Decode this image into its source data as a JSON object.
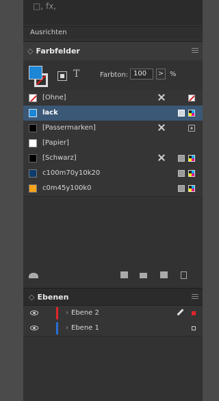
{
  "top": {
    "icons_text": "□, fx,"
  },
  "ausrichten": {
    "label": "Ausrichten"
  },
  "swatches_panel": {
    "title": "Farbfelder",
    "tint_label": "Farbton:",
    "tint_value": "100",
    "tint_arrow": ">",
    "tint_unit": "%",
    "swatches": [
      {
        "name": "[Ohne]",
        "color": "none",
        "selected": false
      },
      {
        "name": "lack",
        "color": "#1d86d6",
        "selected": true
      },
      {
        "name": "[Passermarken]",
        "color": "#000000",
        "selected": false
      },
      {
        "name": "[Papier]",
        "color": "#ffffff",
        "selected": false
      },
      {
        "name": "[Schwarz]",
        "color": "#000000",
        "selected": false
      },
      {
        "name": "c100m70y10k20",
        "color": "#0e3c6e",
        "selected": false
      },
      {
        "name": "c0m45y100k0",
        "color": "#f7a21b",
        "selected": false
      }
    ]
  },
  "layers_panel": {
    "title": "Ebenen",
    "layers": [
      {
        "name": "Ebene 2",
        "color": "#e0262a"
      },
      {
        "name": "Ebene 1",
        "color": "#2a6fd6"
      }
    ]
  }
}
